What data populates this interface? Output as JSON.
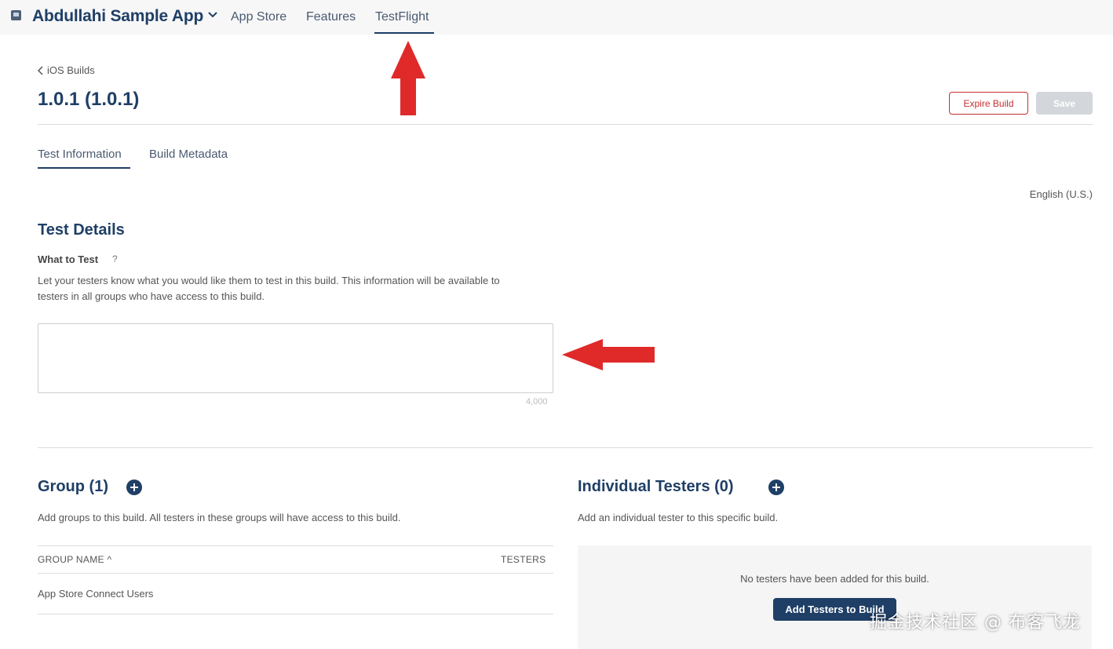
{
  "topnav": {
    "app_name": "Abdullahi Sample App",
    "links": [
      "App Store",
      "Features",
      "TestFlight"
    ],
    "active_link": "TestFlight"
  },
  "header": {
    "back_label": "iOS Builds",
    "title": "1.0.1 (1.0.1)",
    "expire_label": "Expire Build",
    "save_label": "Save"
  },
  "tabs": [
    "Test Information",
    "Build Metadata"
  ],
  "locale": "English (U.S.)",
  "test_details": {
    "title": "Test Details",
    "field_label": "What to Test",
    "help": "?",
    "description_line1": "Let your testers know what you would like them to test in this build. This information will be available to",
    "description_line2": "testers in all groups who have access to this build.",
    "value": "",
    "char_limit": "4,000"
  },
  "groups": {
    "title": "Group (1)",
    "description": "Add groups to this build. All testers in these groups will have access to this build.",
    "col_name": "GROUP NAME",
    "col_testers": "TESTERS",
    "rows": [
      "App Store Connect Users"
    ]
  },
  "individual": {
    "title": "Individual Testers (0)",
    "description": "Add an individual tester to this specific build.",
    "empty_message": "No testers have been added for this build.",
    "add_label": "Add Testers to Build"
  },
  "watermark": "掘金技术社区 @ 布客飞龙",
  "colors": {
    "brand": "#1f3f66",
    "danger": "#c82f2f",
    "annotation": "#e02a2a"
  }
}
